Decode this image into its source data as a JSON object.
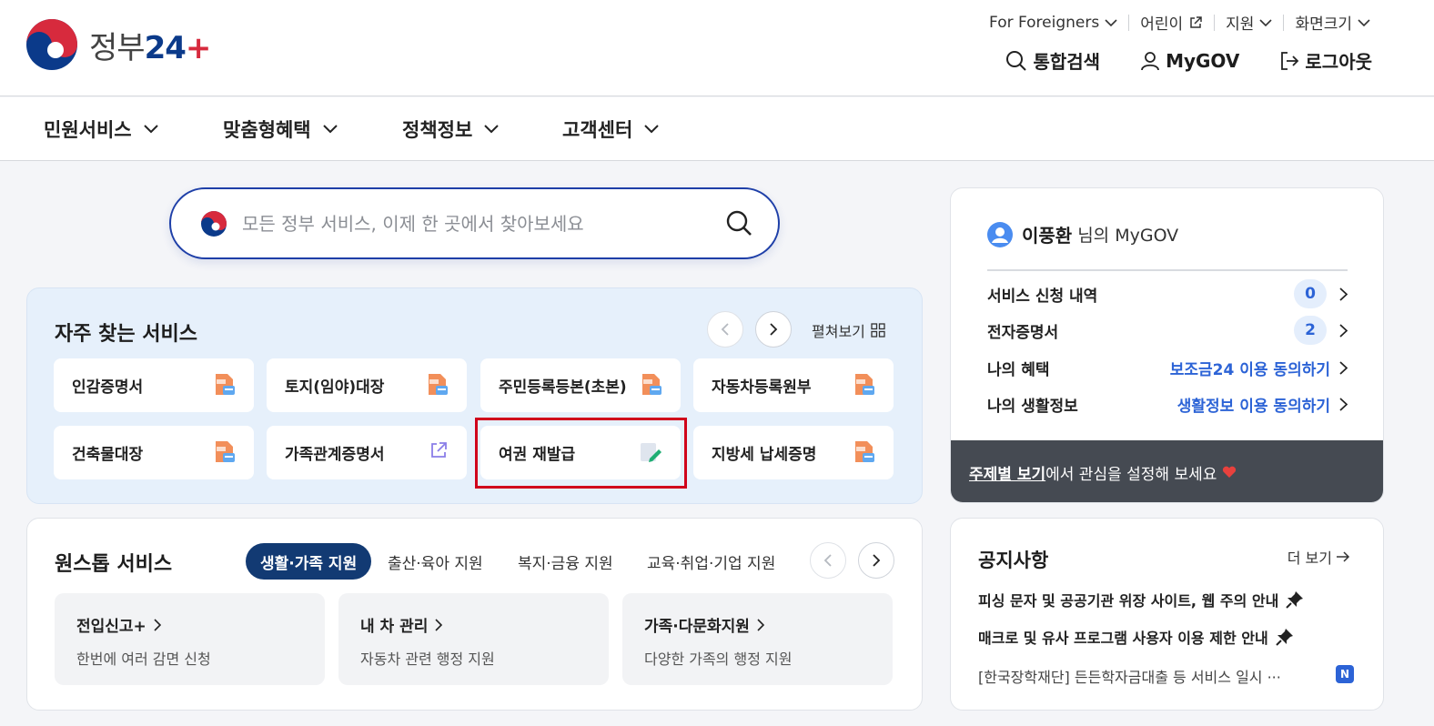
{
  "logo": {
    "text_prefix": "정부",
    "text_num": "24",
    "text_plus": "+",
    "emblem_icon": "taegeuk-emblem-icon"
  },
  "util_links": [
    {
      "label": "For Foreigners",
      "icon": "chevron-down-icon"
    },
    {
      "label": "어린이",
      "icon": "external-link-icon"
    },
    {
      "label": "지원",
      "icon": "chevron-down-icon"
    },
    {
      "label": "화면크기",
      "icon": "chevron-down-icon"
    }
  ],
  "header_actions": [
    {
      "label": "통합검색",
      "icon": "search-icon"
    },
    {
      "label": "MyGOV",
      "icon": "user-icon"
    },
    {
      "label": "로그아웃",
      "icon": "logout-icon"
    }
  ],
  "nav": [
    "민원서비스",
    "맞춤형혜택",
    "정책정보",
    "고객센터"
  ],
  "search": {
    "placeholder": "모든 정부 서비스, 이제 한 곳에서 찾아보세요"
  },
  "frequent": {
    "title": "자주 찾는 서비스",
    "expand_label": "펼쳐보기",
    "tiles": [
      {
        "label": "인감증명서",
        "icon": "pdf-doc-icon"
      },
      {
        "label": "토지(임야)대장",
        "icon": "pdf-doc-icon"
      },
      {
        "label": "주민등록등본(초본)",
        "icon": "pdf-doc-icon"
      },
      {
        "label": "자동차등록원부",
        "icon": "pdf-doc-icon"
      },
      {
        "label": "건축물대장",
        "icon": "pdf-doc-icon"
      },
      {
        "label": "가족관계증명서",
        "icon": "external-link-icon"
      },
      {
        "label": "여권 재발급",
        "icon": "edit-doc-icon"
      },
      {
        "label": "지방세 납세증명",
        "icon": "pdf-doc-icon"
      }
    ]
  },
  "onestop": {
    "title": "원스톱 서비스",
    "tabs": [
      "생활·가족 지원",
      "출산·육아 지원",
      "복지·금융 지원",
      "교육·취업·기업 지원"
    ],
    "active_tab": "생활·가족 지원",
    "cards": [
      {
        "title": "전입신고+",
        "desc": "한번에 여러 감면 신청"
      },
      {
        "title": "내 차 관리",
        "desc": "자동차 관련 행정 지원"
      },
      {
        "title": "가족·다문화지원",
        "desc": "다양한 가족의 행정 지원"
      }
    ]
  },
  "mygov": {
    "user_name": "이풍환",
    "suffix": "님의 MyGOV",
    "rows": [
      {
        "label": "서비스 신청 내역",
        "count": "0"
      },
      {
        "label": "전자증명서",
        "count": "2"
      },
      {
        "label": "나의 혜택",
        "link": "보조금24 이용 동의하기"
      },
      {
        "label": "나의 생활정보",
        "link": "생활정보 이용 동의하기"
      }
    ],
    "bottom_link": "주제별 보기",
    "bottom_text": "에서 관심을 설정해 보세요"
  },
  "notice": {
    "title": "공지사항",
    "more": "더 보기",
    "items": [
      "피싱 문자 및 공공기관 위장 사이트, 웹 주의 안내",
      "매크로 및 유사 프로그램 사용자 이용 제한 안내",
      "[한국장학재단] 든든학자금대출 등 서비스 일시 ···"
    ],
    "new_badge": "N"
  },
  "colors": {
    "primary": "#1e3fa8",
    "navy": "#123a73",
    "link_blue": "#2c63d6",
    "highlight_red": "#d0021b"
  }
}
